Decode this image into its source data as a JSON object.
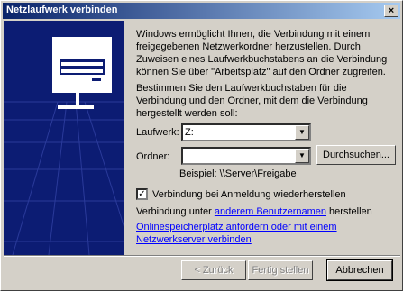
{
  "window": {
    "title": "Netzlaufwerk verbinden",
    "close_label": "×"
  },
  "intro": "Windows ermöglicht Ihnen, die Verbindung mit einem freigegebenen Netzwerkordner herzustellen. Durch Zuweisen eines Laufwerkbuchstabens an die Verbindung können Sie über \"Arbeitsplatz\" auf den Ordner zugreifen.",
  "instruction": "Bestimmen Sie den Laufwerkbuchstaben für die Verbindung und den Ordner, mit dem die Verbindung hergestellt werden soll:",
  "drive": {
    "label": "Laufwerk:",
    "value": "Z:"
  },
  "folder": {
    "label": "Ordner:",
    "value": "",
    "browse_label": "Durchsuchen..."
  },
  "example": "Beispiel: \\\\Server\\Freigabe",
  "reconnect": {
    "label": "Verbindung bei Anmeldung wiederherstellen",
    "checked": true
  },
  "other_user": {
    "prefix": "Verbindung unter ",
    "link": "anderem Benutzernamen",
    "suffix": " herstellen"
  },
  "online_link": "Onlinespeicherplatz anfordern oder mit einem Netzwerkserver verbinden",
  "buttons": {
    "back": "< Zurück",
    "finish": "Fertig stellen",
    "cancel": "Abbrechen"
  }
}
